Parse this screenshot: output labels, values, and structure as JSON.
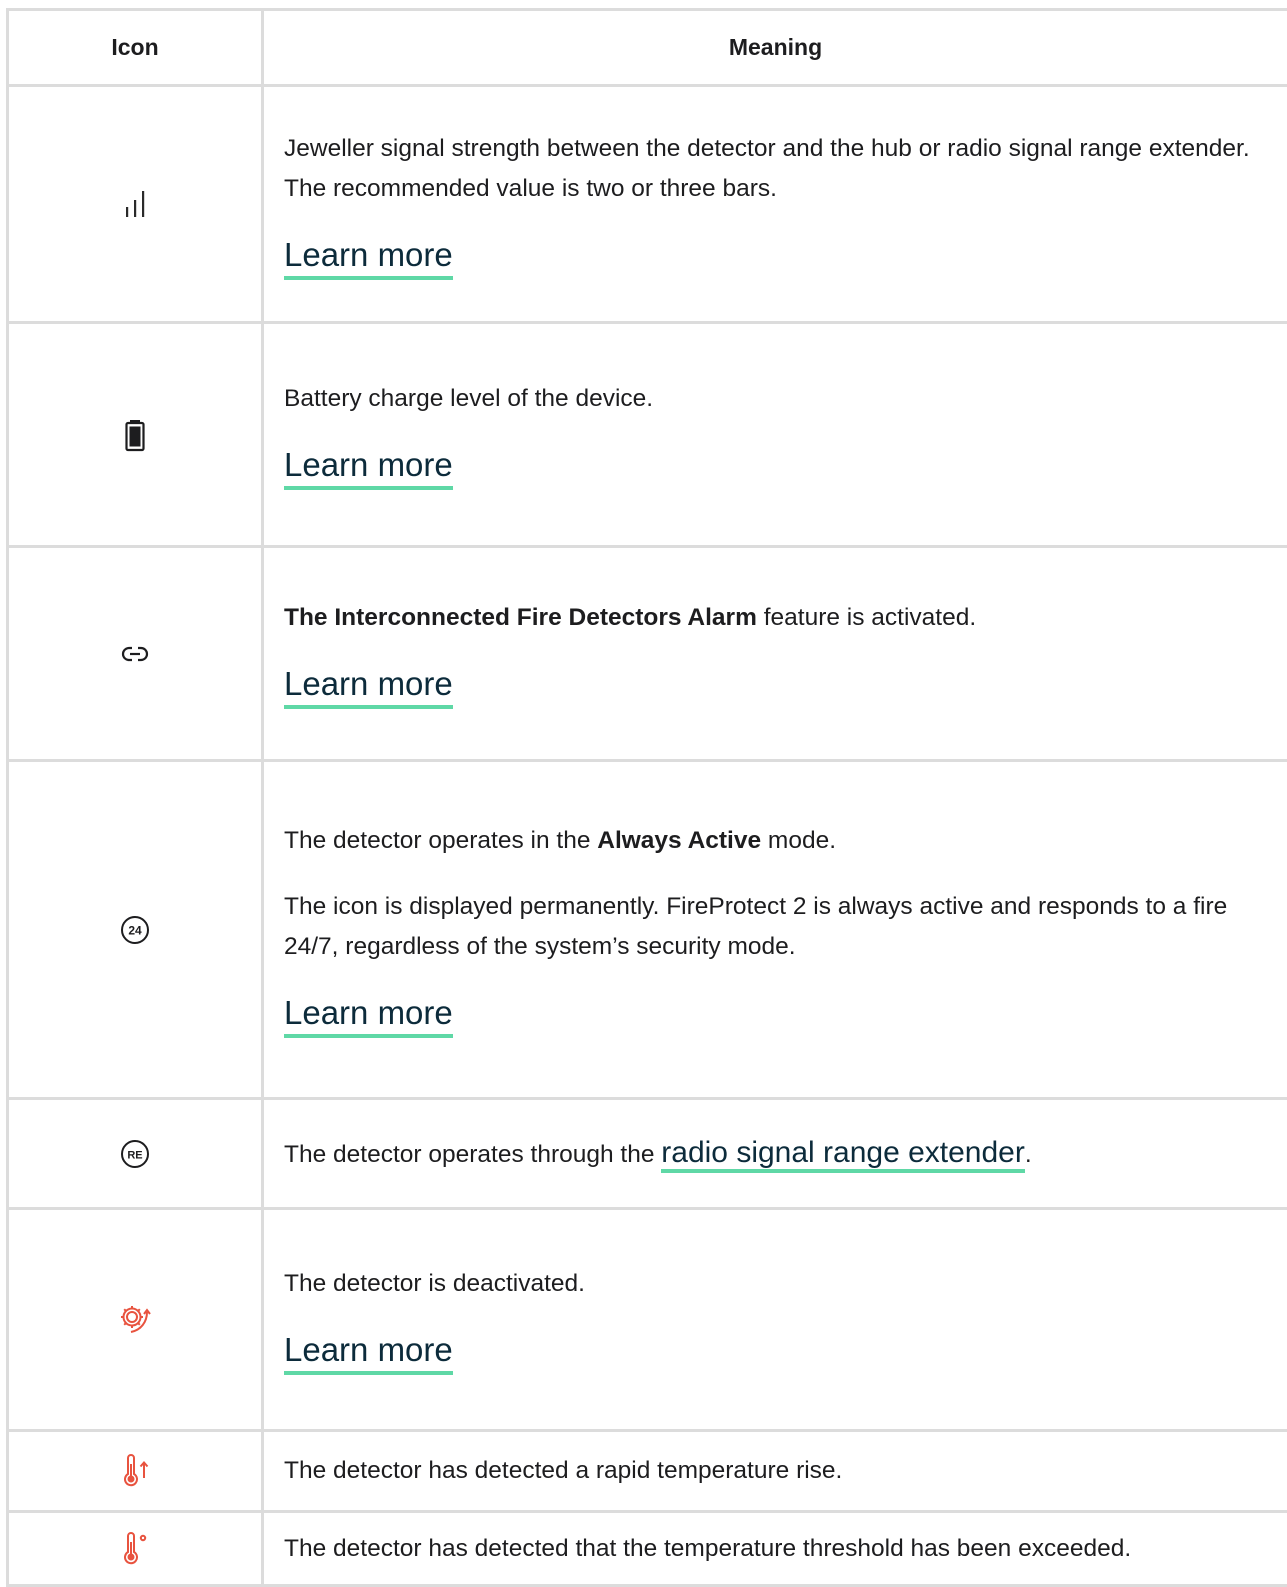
{
  "table": {
    "headers": {
      "icon": "Icon",
      "meaning": "Meaning"
    },
    "rows": [
      {
        "icon": "signal-strength-icon",
        "text": "Jeweller signal strength between the detector and the hub or radio signal range extender. The recommended value is two or three bars.",
        "link": "Learn more"
      },
      {
        "icon": "battery-icon",
        "text": "Battery charge level of the device.",
        "link": "Learn more"
      },
      {
        "icon": "link-icon",
        "bold": "The Interconnected Fire Detectors Alarm",
        "text": " feature is activated.",
        "link": "Learn more"
      },
      {
        "icon": "always-active-24-icon",
        "icon_label": "24",
        "pre": "The detector operates in the ",
        "bold": "Always Active",
        "post": " mode.",
        "text2": "The icon is displayed permanently. FireProtect 2 is always active and responds to a fire 24/7, regardless of the system’s security mode.",
        "link": "Learn more"
      },
      {
        "icon": "range-extender-re-icon",
        "icon_label": "RE",
        "pre": "The detector operates through the ",
        "link": "radio signal range extender",
        "post": "."
      },
      {
        "icon": "deactivated-gear-icon",
        "text": "The detector is deactivated.",
        "link": "Learn more"
      },
      {
        "icon": "temperature-rise-icon",
        "text": "The detector has detected a rapid temperature rise."
      },
      {
        "icon": "temperature-threshold-icon",
        "text": "The detector has detected that the temperature threshold has been exceeded."
      }
    ]
  },
  "colors": {
    "link_underline": "#5fd8a6",
    "alert_icon": "#e8533f",
    "border": "#dcdcdc"
  }
}
